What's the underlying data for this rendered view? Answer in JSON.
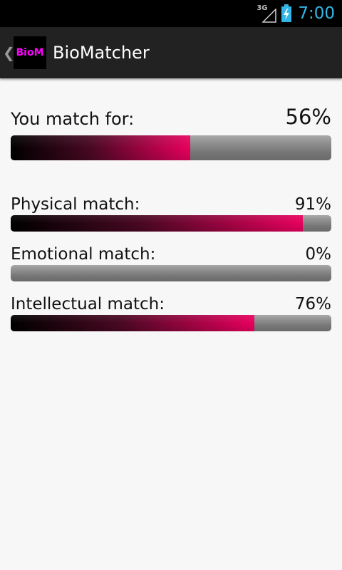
{
  "status_bar": {
    "network_type": "3G",
    "signal_icon": "cell-signal-icon",
    "battery_icon": "battery-charging-icon",
    "time": "7:00",
    "clock_color": "#33b5e5"
  },
  "action_bar": {
    "logo_text": "BioM",
    "logo_color": "#ff00ff",
    "title": "BioMatcher",
    "up_icon": "chevron-left-icon"
  },
  "overall": {
    "label": "You match for:",
    "value_text": "56%",
    "percent": 56
  },
  "matches": [
    {
      "label": "Physical match:",
      "value_text": "91%",
      "percent": 91
    },
    {
      "label": "Emotional match:",
      "value_text": "0%",
      "percent": 0
    },
    {
      "label": "Intellectual match:",
      "value_text": "76%",
      "percent": 76
    }
  ],
  "colors": {
    "bar_fill_start": "#000000",
    "bar_fill_end": "#e8005e",
    "bar_track": "#8c8c8c",
    "background": "#f7f7f7"
  }
}
